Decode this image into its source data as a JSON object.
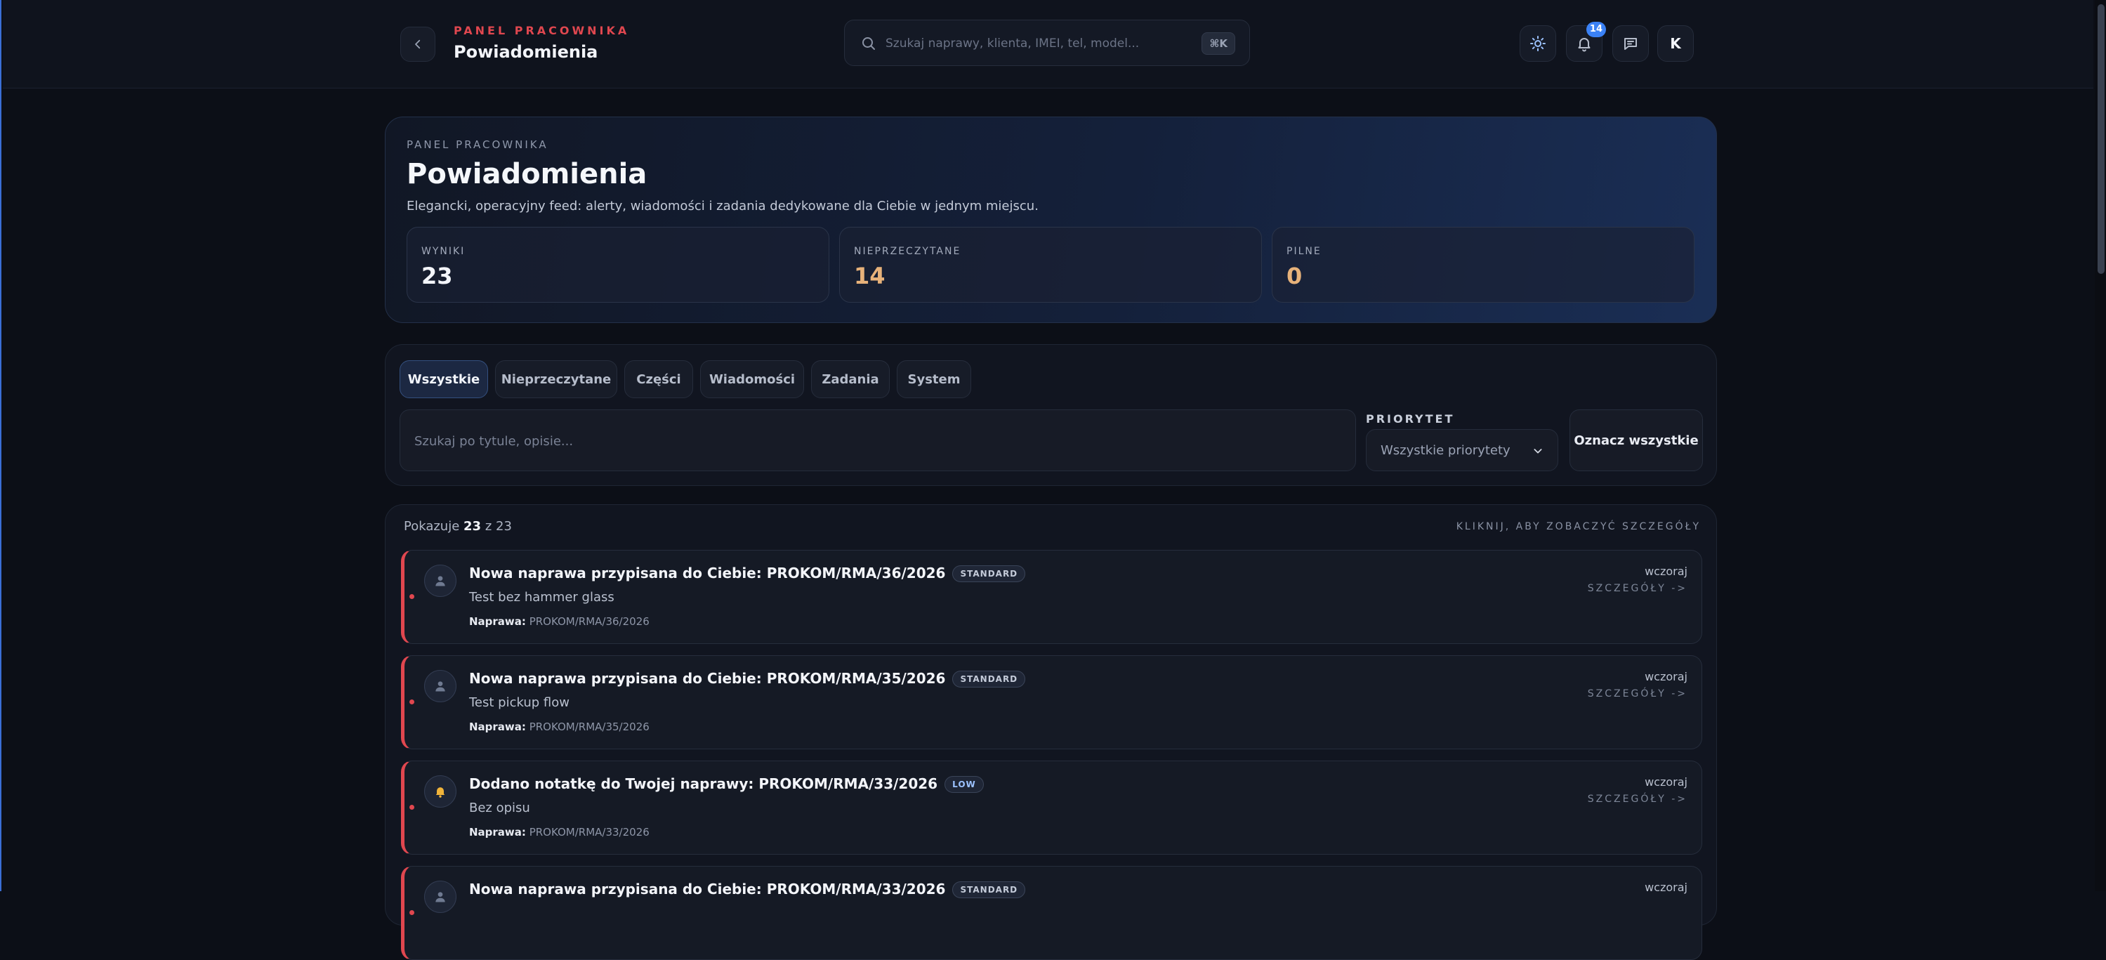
{
  "header": {
    "kicker": "PANEL PRACOWNIKA",
    "title": "Powiadomienia",
    "search_placeholder": "Szukaj naprawy, klienta, IMEI, tel, model...",
    "shortcut": "⌘K",
    "notification_count": "14",
    "avatar_initial": "K",
    "icons": [
      "chevron-left-icon",
      "search-icon",
      "sun-icon",
      "bell-icon",
      "chat-icon"
    ]
  },
  "hero": {
    "kicker": "PANEL PRACOWNIKA",
    "title": "Powiadomienia",
    "subtitle": "Elegancki, operacyjny feed: alerty, wiadomości i zadania dedykowane dla Ciebie w jednym miejscu.",
    "stats": [
      {
        "label": "WYNIKI",
        "value": "23",
        "color": "#f3f5fa"
      },
      {
        "label": "NIEPRZECZYTANE",
        "value": "14",
        "color": "#e7b27a"
      },
      {
        "label": "PILNE",
        "value": "0",
        "color": "#e7b27a"
      }
    ]
  },
  "filters": {
    "tabs": [
      "Wszystkie",
      "Nieprzeczytane",
      "Części",
      "Wiadomości",
      "Zadania",
      "System"
    ],
    "active_tab": "Wszystkie",
    "search_placeholder": "Szukaj po tytule, opisie...",
    "priority_label": "PRIORYTET",
    "priority_value": "Wszystkie priorytety",
    "mark_all": "Oznacz wszystkie"
  },
  "list": {
    "showing_prefix": "Pokazuje",
    "showing_count": "23",
    "showing_suffix": "z 23",
    "hint": "KLIKNIJ, ABY ZOBACZYĆ SZCZEGÓŁY",
    "items": [
      {
        "icon": "user-icon",
        "title": "Nowa naprawa przypisana do Ciebie: PROKOM/RMA/36/2026",
        "badge": "STANDARD",
        "description": "Test bez hammer glass",
        "meta_label": "Naprawa:",
        "meta_value": "PROKOM/RMA/36/2026",
        "when": "wczoraj",
        "details": "SZCZEGÓŁY ->"
      },
      {
        "icon": "user-icon",
        "title": "Nowa naprawa przypisana do Ciebie: PROKOM/RMA/35/2026",
        "badge": "STANDARD",
        "description": "Test pickup flow",
        "meta_label": "Naprawa:",
        "meta_value": "PROKOM/RMA/35/2026",
        "when": "wczoraj",
        "details": "SZCZEGÓŁY ->"
      },
      {
        "icon": "bell-icon",
        "title": "Dodano notatkę do Twojej naprawy: PROKOM/RMA/33/2026",
        "badge": "LOW",
        "description": "Bez opisu",
        "meta_label": "Naprawa:",
        "meta_value": "PROKOM/RMA/33/2026",
        "when": "wczoraj",
        "details": "SZCZEGÓŁY ->"
      },
      {
        "icon": "user-icon",
        "title": "Nowa naprawa przypisana do Ciebie: PROKOM/RMA/33/2026",
        "badge": "STANDARD",
        "description": "",
        "meta_label": "",
        "meta_value": "",
        "when": "wczoraj",
        "details": ""
      }
    ]
  },
  "colors": {
    "accent_red": "#e0474f",
    "accent_blue": "#3b82f6",
    "warm": "#e7b27a"
  }
}
